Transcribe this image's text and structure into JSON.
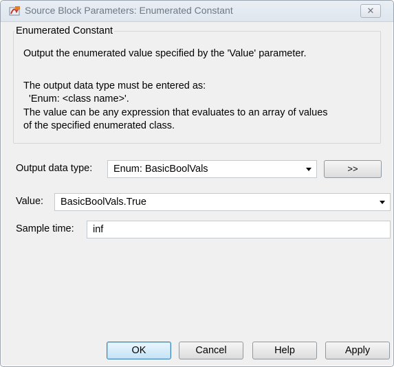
{
  "window": {
    "title": "Source Block Parameters: Enumerated Constant",
    "close_glyph": "✕"
  },
  "description": {
    "group_title": "Enumerated Constant",
    "lines": [
      "Output the enumerated value specified by the 'Value' parameter.",
      "The output data type must be entered as:",
      "  'Enum: <class name>'.",
      "The value can be any expression that evaluates to an array of values",
      "of the specified enumerated class."
    ]
  },
  "parameters": {
    "output_data_type": {
      "label": "Output data type:",
      "value": "Enum: BasicBoolVals",
      "assistant_button": ">>"
    },
    "value": {
      "label": "Value:",
      "value": "BasicBoolVals.True"
    },
    "sample_time": {
      "label": "Sample time:",
      "value": "inf"
    }
  },
  "buttons": {
    "ok": "OK",
    "cancel": "Cancel",
    "help": "Help",
    "apply": "Apply"
  },
  "icons": {
    "app": "simulink-block-icon",
    "close": "close-icon",
    "dropdown": "chevron-down-icon"
  },
  "colors": {
    "dialog_bg": "#f0f0f0",
    "default_button_border": "#3c7fb1",
    "title_text": "#6d7886"
  }
}
